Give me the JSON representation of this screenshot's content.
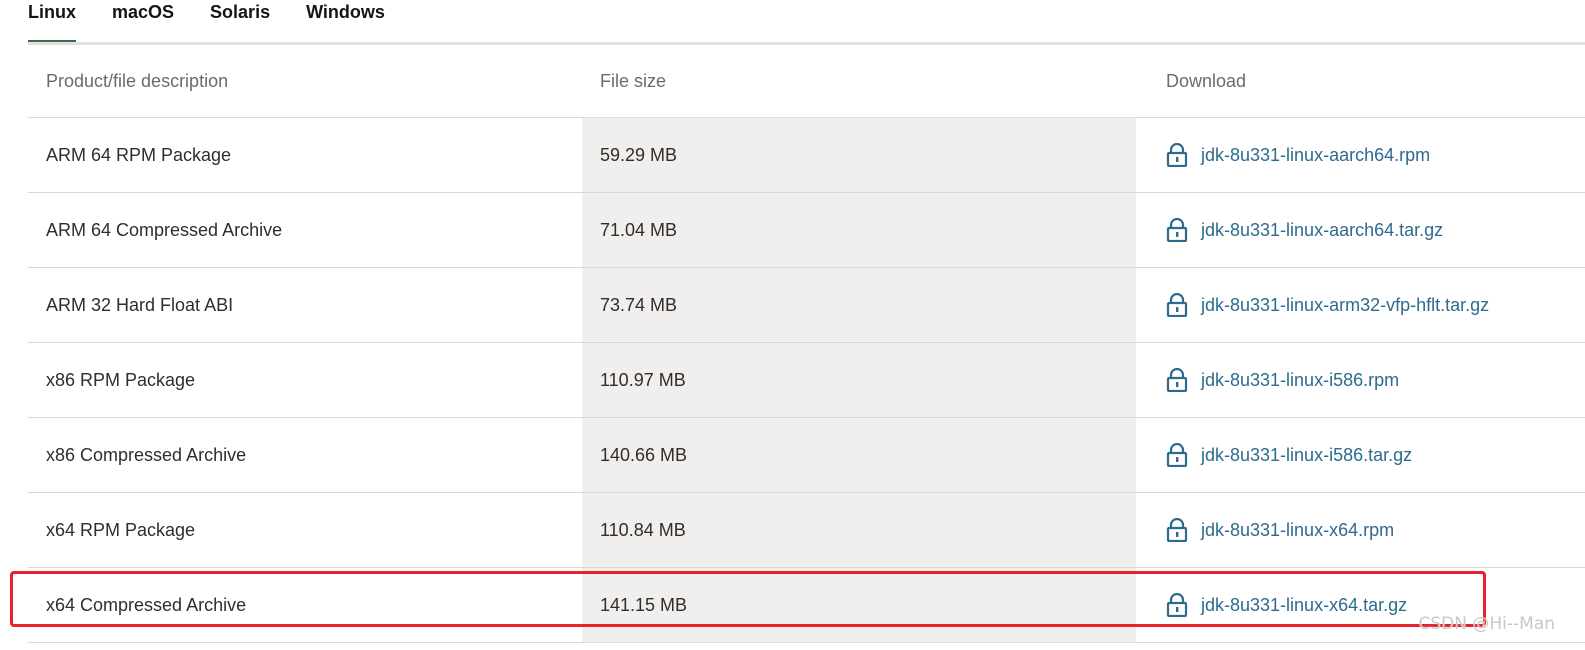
{
  "tabs": [
    {
      "label": "Linux",
      "active": true
    },
    {
      "label": "macOS",
      "active": false
    },
    {
      "label": "Solaris",
      "active": false
    },
    {
      "label": "Windows",
      "active": false
    }
  ],
  "table": {
    "headers": {
      "description": "Product/file description",
      "size": "File size",
      "download": "Download"
    },
    "rows": [
      {
        "description": "ARM 64 RPM Package",
        "size": "59.29 MB",
        "file": "jdk-8u331-linux-aarch64.rpm"
      },
      {
        "description": "ARM 64 Compressed Archive",
        "size": "71.04 MB",
        "file": "jdk-8u331-linux-aarch64.tar.gz"
      },
      {
        "description": "ARM 32 Hard Float ABI",
        "size": "73.74 MB",
        "file": "jdk-8u331-linux-arm32-vfp-hflt.tar.gz"
      },
      {
        "description": "x86 RPM Package",
        "size": "110.97 MB",
        "file": "jdk-8u331-linux-i586.rpm"
      },
      {
        "description": "x86 Compressed Archive",
        "size": "140.66 MB",
        "file": "jdk-8u331-linux-i586.tar.gz"
      },
      {
        "description": "x64 RPM Package",
        "size": "110.84 MB",
        "file": "jdk-8u331-linux-x64.rpm"
      },
      {
        "description": "x64 Compressed Archive",
        "size": "141.15 MB",
        "file": "jdk-8u331-linux-x64.tar.gz"
      }
    ]
  },
  "icons": {
    "download": "lock-icon"
  },
  "colors": {
    "link": "#2d6b8e",
    "active_tab_underline": "#3e6a52",
    "highlight": "#e8222a",
    "size_column_bg": "#f1efed"
  },
  "watermark": "CSDN @Hi--Man"
}
